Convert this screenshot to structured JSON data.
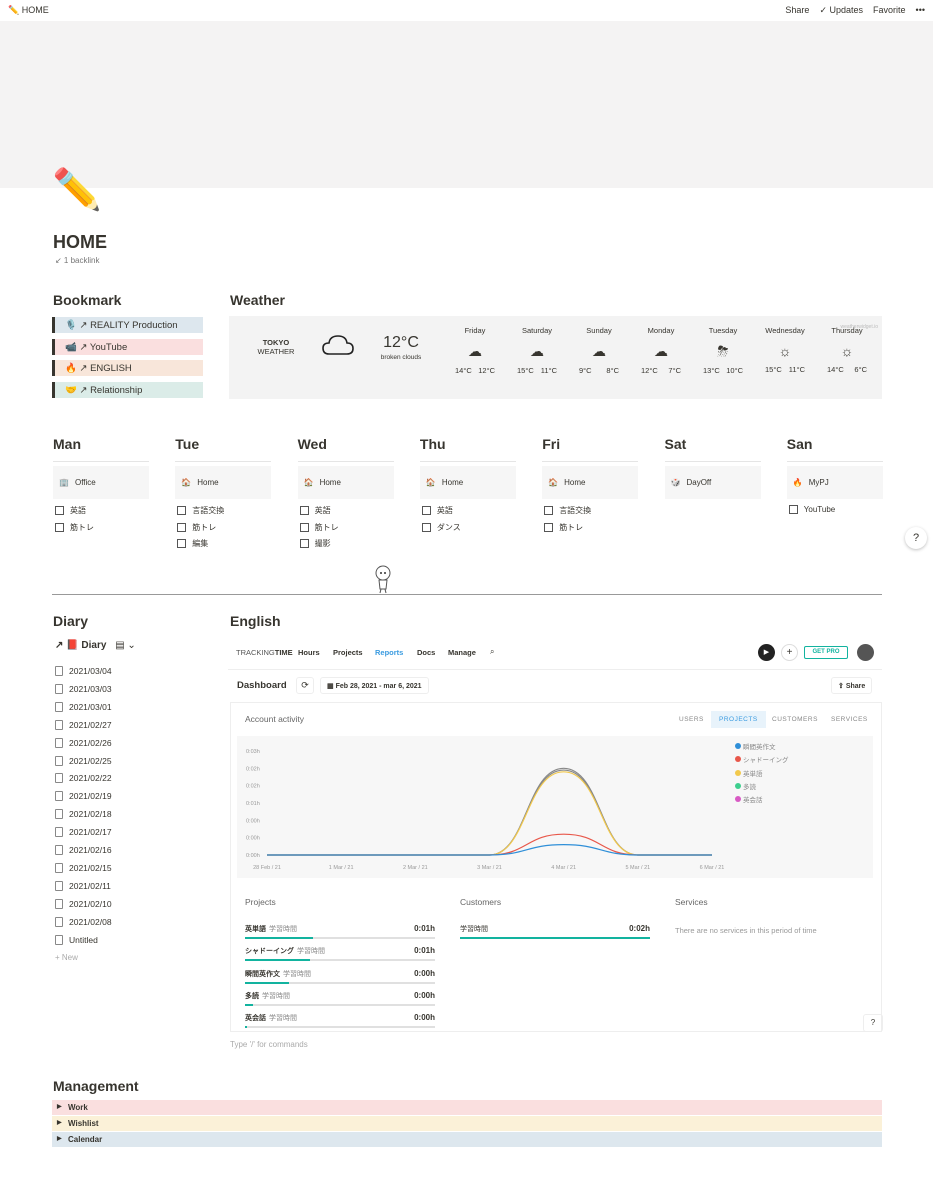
{
  "topbar": {
    "icon": "✏️",
    "title": "HOME",
    "share": "Share",
    "updates": "Updates",
    "favorite": "Favorite",
    "more": "•••"
  },
  "page": {
    "icon": "✏️",
    "title": "HOME",
    "backlink": "↙ 1 backlink"
  },
  "bookmark": {
    "title": "Bookmark",
    "items": [
      {
        "label": "🎙️ ↗ REALITY Production",
        "color": "#dde7ee"
      },
      {
        "label": "📹 ↗ YouTube",
        "color": "#fadfdf"
      },
      {
        "label": "🔥 ↗ ENGLISH",
        "color": "#f8e6da"
      },
      {
        "label": "🤝 ↗ Relationship",
        "color": "#dbece8"
      }
    ]
  },
  "weather": {
    "title": "Weather",
    "city": "TOKYO",
    "label": "WEATHER",
    "current_temp": "12°C",
    "current_desc": "broken clouds",
    "credit": "weatherwidget.io",
    "days": [
      {
        "name": "Friday",
        "icon": "☁",
        "high": "14°C",
        "low": "12°C"
      },
      {
        "name": "Saturday",
        "icon": "☁",
        "high": "15°C",
        "low": "11°C"
      },
      {
        "name": "Sunday",
        "icon": "☁",
        "high": "9°C",
        "low": "8°C"
      },
      {
        "name": "Monday",
        "icon": "☁",
        "high": "12°C",
        "low": "7°C"
      },
      {
        "name": "Tuesday",
        "icon": "⛈",
        "high": "13°C",
        "low": "10°C"
      },
      {
        "name": "Wednesday",
        "icon": "☼",
        "high": "15°C",
        "low": "11°C"
      },
      {
        "name": "Thursday",
        "icon": "☼",
        "high": "14°C",
        "low": "6°C"
      }
    ]
  },
  "week": [
    {
      "day": "Man",
      "card": {
        "emoji": "🏢",
        "label": "Office"
      },
      "todos": [
        "英語",
        "筋トレ"
      ]
    },
    {
      "day": "Tue",
      "card": {
        "emoji": "🏠",
        "label": "Home"
      },
      "todos": [
        "言語交換",
        "筋トレ",
        "編集"
      ]
    },
    {
      "day": "Wed",
      "card": {
        "emoji": "🏠",
        "label": "Home"
      },
      "todos": [
        "英語",
        "筋トレ",
        "撮影"
      ]
    },
    {
      "day": "Thu",
      "card": {
        "emoji": "🏠",
        "label": "Home"
      },
      "todos": [
        "英語",
        "ダンス"
      ]
    },
    {
      "day": "Fri",
      "card": {
        "emoji": "🏠",
        "label": "Home"
      },
      "todos": [
        "言語交換",
        "筋トレ"
      ]
    },
    {
      "day": "Sat",
      "card": {
        "emoji": "🎲",
        "label": "DayOff"
      },
      "todos": []
    },
    {
      "day": "San",
      "card": {
        "emoji": "🔥",
        "label": "MyPJ"
      },
      "todos": [
        "YouTube"
      ]
    }
  ],
  "diary": {
    "title": "Diary",
    "db_title": "↗ 📕 Diary",
    "entries": [
      "2021/03/04",
      "2021/03/03",
      "2021/03/01",
      "2021/02/27",
      "2021/02/26",
      "2021/02/25",
      "2021/02/22",
      "2021/02/19",
      "2021/02/18",
      "2021/02/17",
      "2021/02/16",
      "2021/02/15",
      "2021/02/11",
      "2021/02/10",
      "2021/02/08",
      "Untitled"
    ],
    "new_label": "+ New"
  },
  "english": {
    "title": "English",
    "brand_a": "TRACKING",
    "brand_b": "TIME",
    "nav": [
      "Hours",
      "Projects",
      "Reports",
      "Docs",
      "Manage"
    ],
    "get_pro": "GET PRO",
    "dashboard": "Dashboard",
    "date_range": "Feb 28, 2021 - mar 6, 2021",
    "share": "Share",
    "account_activity": "Account activity",
    "tabs": [
      "USERS",
      "PROJECTS",
      "CUSTOMERS",
      "SERVICES"
    ],
    "projects_title": "Projects",
    "customers_title": "Customers",
    "services_title": "Services",
    "projects": [
      {
        "name": "英単語",
        "sub": "学習時間",
        "time": "0:01h",
        "fill": 0.36
      },
      {
        "name": "シャドーイング",
        "sub": "学習時間",
        "time": "0:01h",
        "fill": 0.34
      },
      {
        "name": "瞬間英作文",
        "sub": "学習時間",
        "time": "0:00h",
        "fill": 0.23
      },
      {
        "name": "多読",
        "sub": "学習時間",
        "time": "0:00h",
        "fill": 0.04
      },
      {
        "name": "英会話",
        "sub": "学習時間",
        "time": "0:00h",
        "fill": 0.01
      }
    ],
    "customers": [
      {
        "name": "学習時間",
        "time": "0:02h",
        "fill": 1.0
      }
    ],
    "services_empty": "There are no services in this period of time",
    "placeholder": "Type '/' for commands"
  },
  "chart_data": {
    "type": "line",
    "x": [
      "28 Feb / 21",
      "1 Mar / 21",
      "2 Mar / 21",
      "3 Mar / 21",
      "4 Mar / 21",
      "5 Mar / 21",
      "6 Mar / 21"
    ],
    "yticks": [
      "0:00h",
      "0:00h",
      "0:00h",
      "0:01h",
      "0:02h",
      "0:02h",
      "0:03h"
    ],
    "ylim": [
      0,
      3
    ],
    "series": [
      {
        "name": "瞬間英作文",
        "color": "#2f8fd8",
        "values": [
          0,
          0,
          0,
          0,
          0.3,
          0,
          0
        ]
      },
      {
        "name": "シャドーイング",
        "color": "#e8574a",
        "values": [
          0,
          0,
          0,
          0,
          0.6,
          0,
          0
        ]
      },
      {
        "name": "英単語",
        "color": "#f2c94c",
        "values": [
          0,
          0,
          0,
          0,
          2.4,
          0,
          0
        ]
      },
      {
        "name": "多読",
        "color": "#3ecf8e",
        "values": [
          0,
          0,
          0,
          0,
          2.45,
          0,
          0
        ]
      },
      {
        "name": "英会話",
        "color": "#d85ac4",
        "values": [
          0,
          0,
          0,
          0,
          2.5,
          0,
          0
        ]
      }
    ],
    "total_color": "#888888"
  },
  "management": {
    "title": "Management",
    "items": [
      {
        "label": "Work",
        "color": "#fadfdf"
      },
      {
        "label": "Wishlist",
        "color": "#fbf1d8"
      },
      {
        "label": "Calendar",
        "color": "#dde7ee"
      }
    ]
  }
}
